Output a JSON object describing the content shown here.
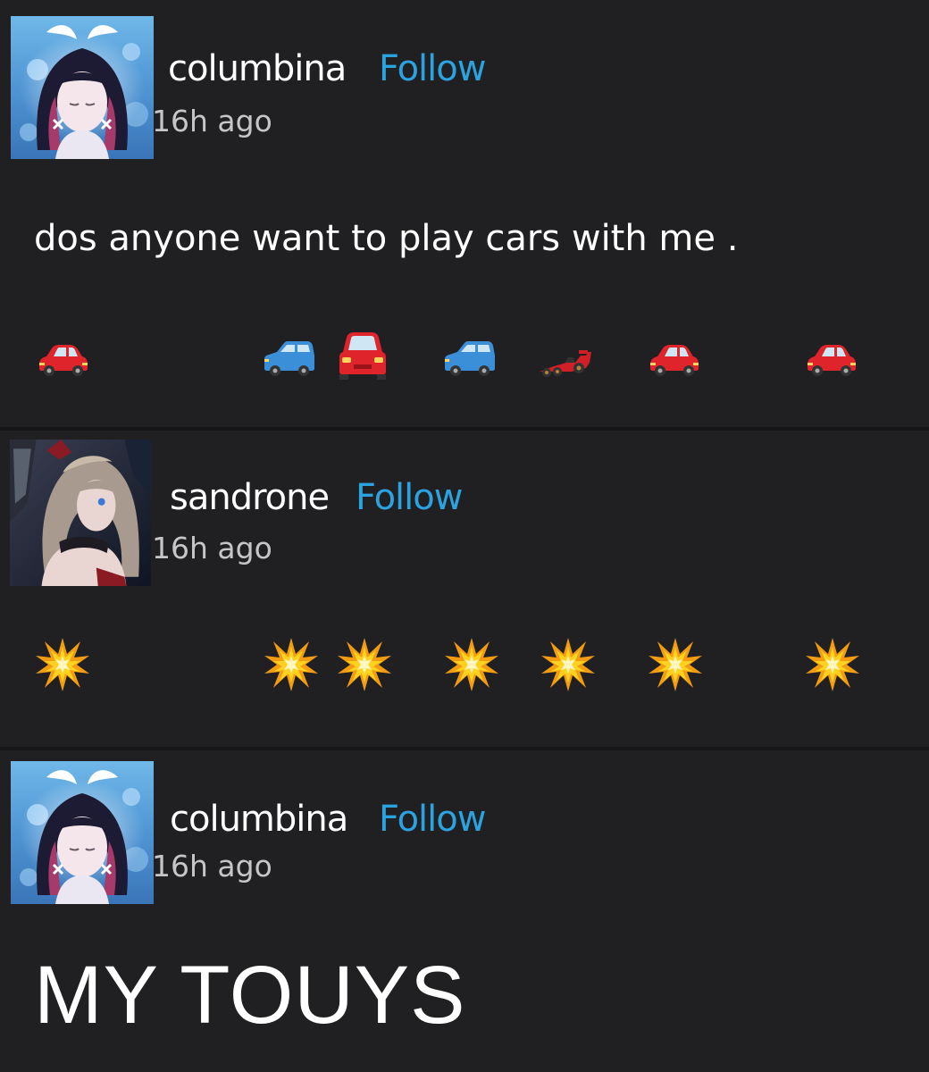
{
  "posts": [
    {
      "username": "columbina",
      "follow_label": "Follow",
      "time": "16h ago",
      "text": "dos anyone want to play cars with me .",
      "emojis": [
        "red-car-icon",
        "blue-car-icon",
        "red-car-front-icon",
        "blue-car-icon",
        "race-car-icon",
        "red-car-icon",
        "red-car-icon"
      ]
    },
    {
      "username": "sandrone",
      "follow_label": "Follow",
      "time": "16h ago",
      "emojis": [
        "collision-icon",
        "collision-icon",
        "collision-icon",
        "collision-icon",
        "collision-icon",
        "collision-icon",
        "collision-icon"
      ]
    },
    {
      "username": "columbina",
      "follow_label": "Follow",
      "time": "16h ago",
      "text": "MY TOUYS"
    }
  ],
  "colors": {
    "background": "#202022",
    "follow": "#2aa3e0",
    "timestamp": "#c6c6c8"
  }
}
